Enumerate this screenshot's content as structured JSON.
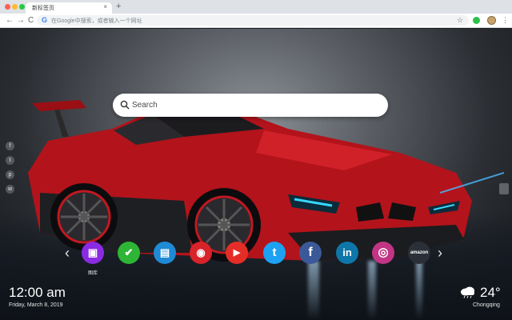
{
  "browser": {
    "tab_title": "新标签页",
    "tab_close": "×",
    "new_tab": "+",
    "back": "←",
    "forward": "→",
    "reload": "C",
    "omnibox_placeholder": "在Google中搜索，或者输入一个网址",
    "google_g": "G",
    "bookmark_star": "☆",
    "menu": "⋮",
    "colors": {
      "close": "#ff5f57",
      "minimize": "#febc2e",
      "maximize": "#28c840"
    }
  },
  "search": {
    "placeholder": "Search"
  },
  "social_icons": [
    {
      "icon": "facebook-icon",
      "glyph": "f"
    },
    {
      "icon": "twitter-icon",
      "glyph": "t"
    },
    {
      "icon": "pinterest-icon",
      "glyph": "p"
    },
    {
      "icon": "wechat-icon",
      "glyph": "w"
    }
  ],
  "apps": {
    "prev": "‹",
    "next": "›",
    "items": [
      {
        "name": "图库",
        "icon": "gallery-icon",
        "color": "#8a2be2",
        "glyph": "▣"
      },
      {
        "name": "",
        "icon": "check-icon",
        "color": "#2fb536",
        "glyph": "✔"
      },
      {
        "name": "",
        "icon": "notes-icon",
        "color": "#1f8ad6",
        "glyph": "▤"
      },
      {
        "name": "",
        "icon": "game-icon",
        "color": "#d8232a",
        "glyph": "◉"
      },
      {
        "name": "",
        "icon": "youtube-icon",
        "color": "#e52d27",
        "glyph": "▶"
      },
      {
        "name": "",
        "icon": "twitter-icon",
        "color": "#1da1f2",
        "glyph": "t"
      },
      {
        "name": "",
        "icon": "facebook-icon",
        "color": "#3b5998",
        "glyph": "f"
      },
      {
        "name": "",
        "icon": "linkedin-icon",
        "color": "#0e76a8",
        "glyph": "in"
      },
      {
        "name": "",
        "icon": "instagram-icon",
        "color": "#c13584",
        "glyph": "◎"
      },
      {
        "name": "",
        "icon": "amazon-icon",
        "color": "#2b3038",
        "glyph": "amazon"
      }
    ]
  },
  "clock": {
    "time": "12:00 am",
    "date": "Friday, March 8, 2019"
  },
  "weather": {
    "temp": "24°",
    "city": "Chongqing",
    "icon": "cloud-rain-icon"
  }
}
